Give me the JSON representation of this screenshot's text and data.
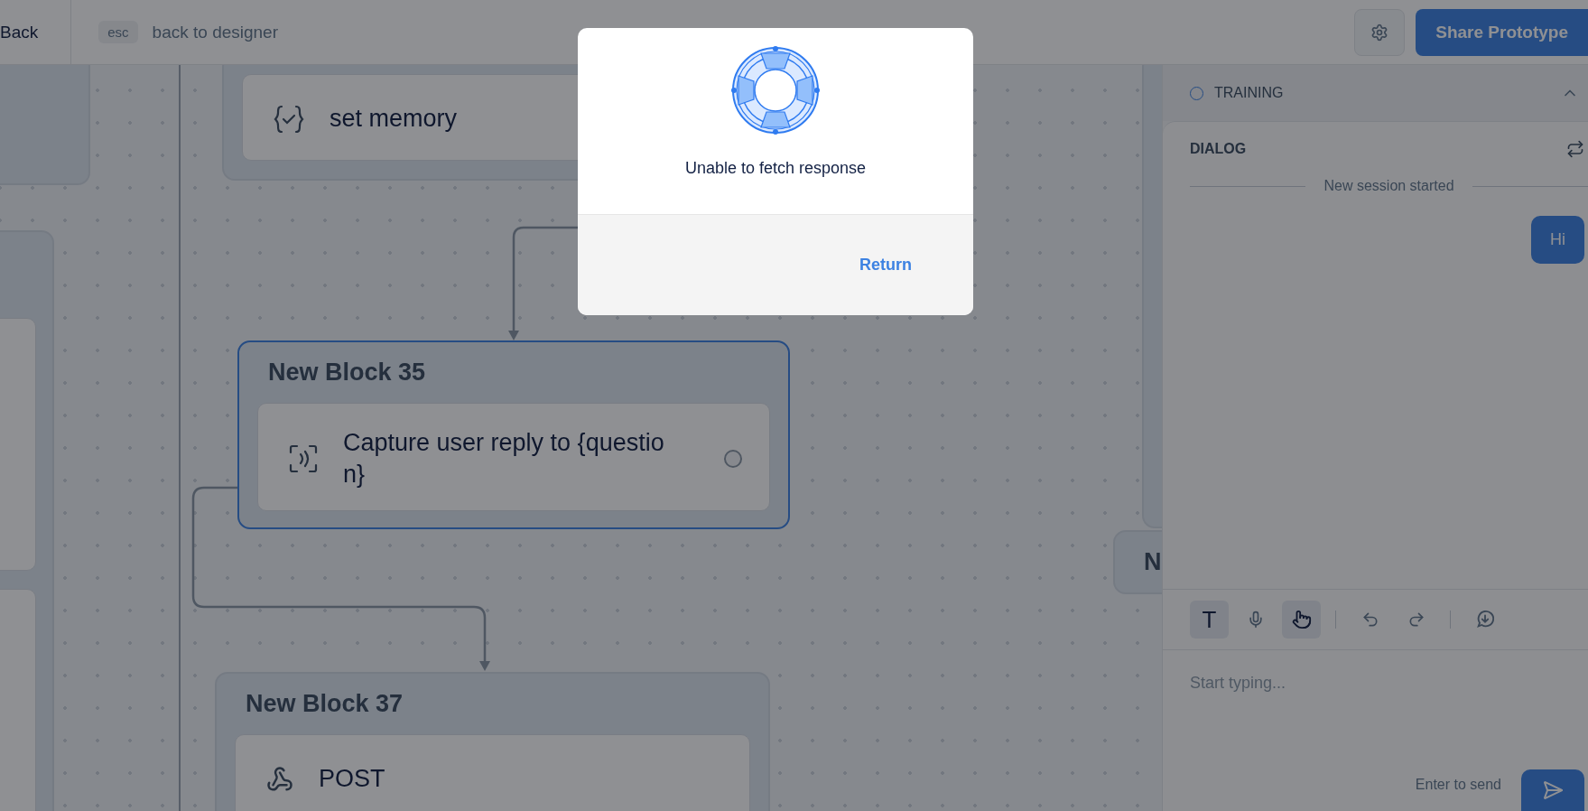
{
  "topbar": {
    "back": "Back",
    "esc_key": "esc",
    "esc_hint": "back to designer",
    "share_button": "Share Prototype"
  },
  "canvas": {
    "blocks": [
      {
        "selected": false,
        "steps": [
          {
            "kind": "set",
            "text": "set memory"
          }
        ]
      },
      {
        "title": "New Block 35",
        "selected": true,
        "steps": [
          {
            "kind": "capture",
            "text": "Capture user reply to {question}"
          }
        ]
      },
      {
        "title": "New Block 37",
        "selected": false,
        "steps": [
          {
            "kind": "api",
            "text": "POST"
          }
        ]
      },
      {
        "title": "N",
        "selected": false
      }
    ]
  },
  "modal": {
    "message": "Unable to fetch response",
    "button": "Return"
  },
  "panel": {
    "training": {
      "label": "TRAINING",
      "expanded": true
    },
    "dialog": {
      "title": "DIALOG",
      "divider": "New session started",
      "messages": [
        {
          "kind": "user",
          "text": "Hi"
        }
      ]
    },
    "tools": [
      {
        "kind": "text",
        "label": "T",
        "selected": true
      },
      {
        "kind": "voice",
        "selected": false
      },
      {
        "kind": "touch",
        "selected": true
      },
      {
        "kind": "separator"
      },
      {
        "kind": "undo",
        "selected": false
      },
      {
        "kind": "redo",
        "selected": false
      },
      {
        "kind": "separator"
      },
      {
        "kind": "download",
        "selected": false
      }
    ],
    "input": {
      "placeholder": "Start typing...",
      "hint": "Enter to send"
    }
  }
}
